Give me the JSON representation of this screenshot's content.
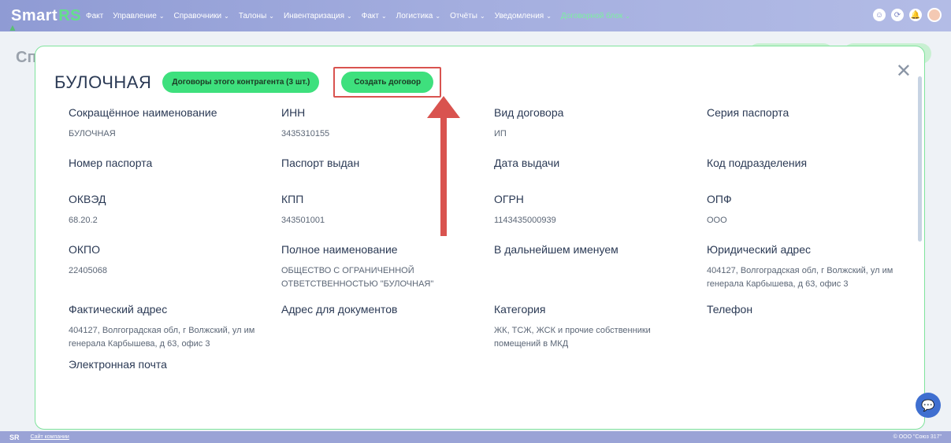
{
  "header": {
    "logo_main": "Smart",
    "logo_accent": "RS",
    "nav": [
      {
        "label": "Факт",
        "active": false
      },
      {
        "label": "Управление",
        "active": false
      },
      {
        "label": "Справочники",
        "active": false
      },
      {
        "label": "Талоны",
        "active": false
      },
      {
        "label": "Инвентаризация",
        "active": false
      },
      {
        "label": "Факт",
        "active": false
      },
      {
        "label": "Логистика",
        "active": false
      },
      {
        "label": "Отчёты",
        "active": false
      },
      {
        "label": "Уведомления",
        "active": false
      },
      {
        "label": "Договорной блок",
        "active": true
      }
    ]
  },
  "background_page": {
    "title": "Сп"
  },
  "modal": {
    "title": "БУЛОЧНАЯ",
    "contracts_button": "Договоры этого контрагента (3 шт.)",
    "create_button": "Создать договор",
    "fields": [
      {
        "label": "Сокращённое наименование",
        "value": "БУЛОЧНАЯ"
      },
      {
        "label": "ИНН",
        "value": "3435310155"
      },
      {
        "label": "Вид договора",
        "value": "ИП"
      },
      {
        "label": "Серия паспорта",
        "value": ""
      },
      {
        "label": "Номер паспорта",
        "value": ""
      },
      {
        "label": "Паспорт выдан",
        "value": ""
      },
      {
        "label": "Дата выдачи",
        "value": ""
      },
      {
        "label": "Код подразделения",
        "value": ""
      },
      {
        "label": "ОКВЭД",
        "value": "68.20.2"
      },
      {
        "label": "КПП",
        "value": "343501001"
      },
      {
        "label": "ОГРН",
        "value": "1143435000939"
      },
      {
        "label": "ОПФ",
        "value": "ООО"
      },
      {
        "label": "ОКПО",
        "value": "22405068"
      },
      {
        "label": "Полное наименование",
        "value": "ОБЩЕСТВО С ОГРАНИЧЕННОЙ ОТВЕТСТВЕННОСТЬЮ \"БУЛОЧНАЯ\""
      },
      {
        "label": "В дальнейшем именуем",
        "value": ""
      },
      {
        "label": "Юридический адрес",
        "value": "404127, Волгоградская обл, г Волжский, ул им генерала Карбышева, д 63, офис 3"
      },
      {
        "label": "Фактический адрес",
        "value": "404127, Волгоградская обл, г Волжский, ул им генерала Карбышева, д 63, офис 3"
      },
      {
        "label": "Адрес для документов",
        "value": ""
      },
      {
        "label": "Категория",
        "value": "ЖК, ТСЖ, ЖСК и прочие собственники помещений в МКД"
      },
      {
        "label": "Телефон",
        "value": ""
      },
      {
        "label": "Электронная почта",
        "value": ""
      }
    ]
  },
  "footer": {
    "brand": "SR",
    "link": "Сайт компании",
    "copyright": "© ООО \"Союз 317\""
  },
  "colors": {
    "accent_green": "#3ee07d",
    "highlight_red": "#d9534f",
    "nav_bg": "#a4aedf"
  }
}
